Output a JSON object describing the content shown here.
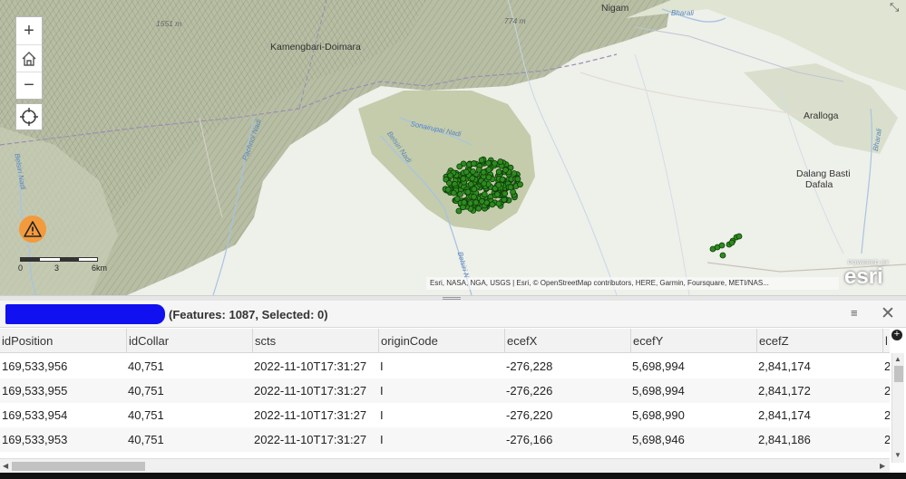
{
  "map": {
    "places": [
      {
        "name": "Nigam"
      },
      {
        "name": "Kamengbari-Doimara"
      },
      {
        "name": "Aralloga"
      },
      {
        "name": "Dalang Basti"
      },
      {
        "name": "Dafala"
      }
    ],
    "elevations": [
      "1551 m",
      "774 m"
    ],
    "rivers": [
      "Bharali",
      "Sonairupai Nadi",
      "Belsiri Nadi",
      "Pachnoi Nadi",
      "Bharali",
      "Belsiri Nadi",
      "Belsiri N"
    ],
    "controls": {
      "zoom_in": "+",
      "home": "⌂",
      "zoom_out": "−"
    },
    "scale": {
      "labels": [
        "0",
        "3",
        "6km"
      ]
    },
    "attribution": "Esri, NASA, NGA, USGS | Esri, © OpenStreetMap contributors, HERE, Garmin, Foursquare, METI/NAS...",
    "powered_by": "POWERED BY",
    "logo_text": "esri",
    "point_color": "#2e8b1f"
  },
  "table": {
    "title": "(Features: 1087, Selected: 0)",
    "menu_icon": "≡",
    "close_icon": "✕",
    "columns": [
      "idPosition",
      "idCollar",
      "scts",
      "originCode",
      "ecefX",
      "ecefY",
      "ecefZ",
      "l"
    ],
    "rows": [
      [
        "169,533,956",
        "40,751",
        "2022-11-10T17:31:27",
        "I",
        "-276,228",
        "5,698,994",
        "2,841,174",
        "2"
      ],
      [
        "169,533,955",
        "40,751",
        "2022-11-10T17:31:27",
        "I",
        "-276,226",
        "5,698,994",
        "2,841,172",
        "2"
      ],
      [
        "169,533,954",
        "40,751",
        "2022-11-10T17:31:27",
        "I",
        "-276,220",
        "5,698,990",
        "2,841,174",
        "2"
      ],
      [
        "169,533,953",
        "40,751",
        "2022-11-10T17:31:27",
        "I",
        "-276,166",
        "5,698,946",
        "2,841,186",
        "2"
      ]
    ]
  }
}
